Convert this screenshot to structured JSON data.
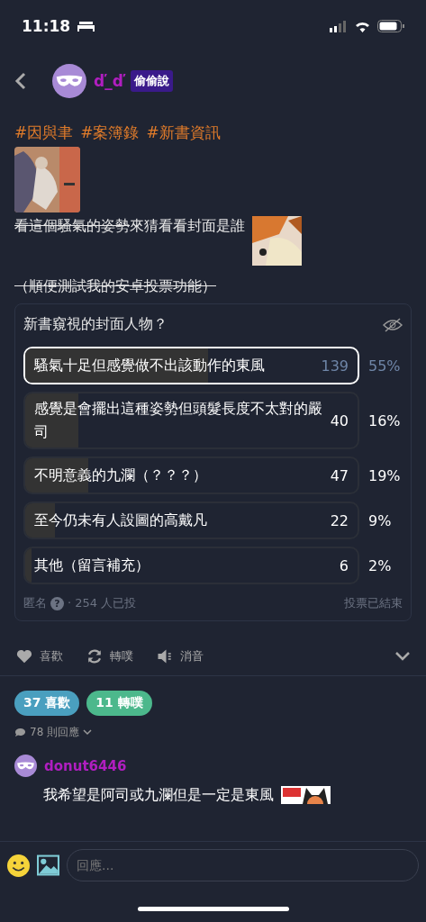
{
  "status_bar": {
    "time": "11:18"
  },
  "header": {
    "username": "ď_ď",
    "badge": "偷偷說"
  },
  "post": {
    "tags": [
      "#因與聿",
      "#案簿錄",
      "#新書資訊"
    ],
    "lines": [
      [
        {
          "text": "看這個騷氣的姿勢",
          "struck": true
        },
        {
          "text": "來猜看看封面是誰",
          "struck": false
        }
      ],
      [
        {
          "text": "（順便測試我的安卓投票功能）",
          "struck": true
        }
      ]
    ]
  },
  "poll": {
    "question": "新書窺視的封面人物？",
    "options": [
      {
        "label": "騷氣十足但感覺做不出該動作的東風",
        "count": "139",
        "percent": "55%",
        "level": 0.55,
        "selected": true
      },
      {
        "label": "感覺是會擺出這種姿勢但頭髮長度不太對的嚴司",
        "count": "40",
        "percent": "16%",
        "level": 0.16,
        "selected": false
      },
      {
        "label": "不明意義的九瀾（？？？）",
        "count": "47",
        "percent": "19%",
        "level": 0.19,
        "selected": false
      },
      {
        "label": "至今仍未有人設圖的高戴凡",
        "count": "22",
        "percent": "9%",
        "level": 0.09,
        "selected": false
      },
      {
        "label": "其他（留言補充）",
        "count": "6",
        "percent": "2%",
        "level": 0.02,
        "selected": false
      }
    ],
    "anonymous": "匿名",
    "help": "?",
    "votes": "· 254 人已投",
    "status": "投票已結束"
  },
  "actions": [
    {
      "kind": "like",
      "label": "喜歡"
    },
    {
      "kind": "replurk",
      "label": "轉噗"
    },
    {
      "kind": "mute",
      "label": "消音"
    }
  ],
  "counts": [
    {
      "label": "37 喜歡",
      "color": "#4a9fbf"
    },
    {
      "label": "11 轉噗",
      "color": "#4cb88c"
    }
  ],
  "responses": "78 則回應",
  "comment": {
    "username": "donut6446",
    "text": "我希望是阿司或九瀾但是一定是東風"
  },
  "reply": {
    "placeholder": "回應..."
  }
}
